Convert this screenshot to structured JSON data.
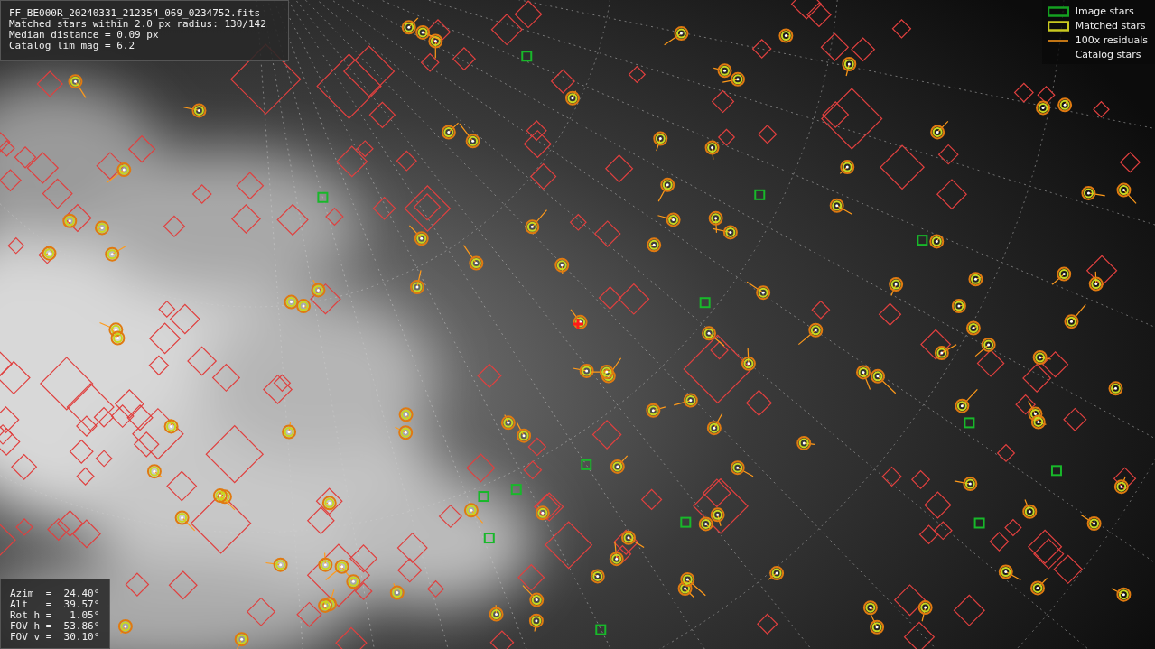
{
  "header": {
    "lines": [
      "FF_BE000R_20240331_212354_069_0234752.fits",
      "Matched stars within 2.0 px radius: 130/142",
      "Median distance = 0.09 px",
      "Catalog lim mag = 6.2"
    ]
  },
  "legend": [
    {
      "label": "Image stars"
    },
    {
      "kind": "matched",
      "label": "Matched stars"
    },
    {
      "kind": "residual",
      "label": "100x residuals"
    },
    {
      "kind": "catalog",
      "label": "Catalog stars"
    }
  ],
  "pointing": {
    "lines": [
      "Azim  =  24.40°",
      "Alt   =  39.57°",
      "Rot h =   1.05°",
      "FOV h =  53.86°",
      "FOV v =  30.10°"
    ]
  }
}
